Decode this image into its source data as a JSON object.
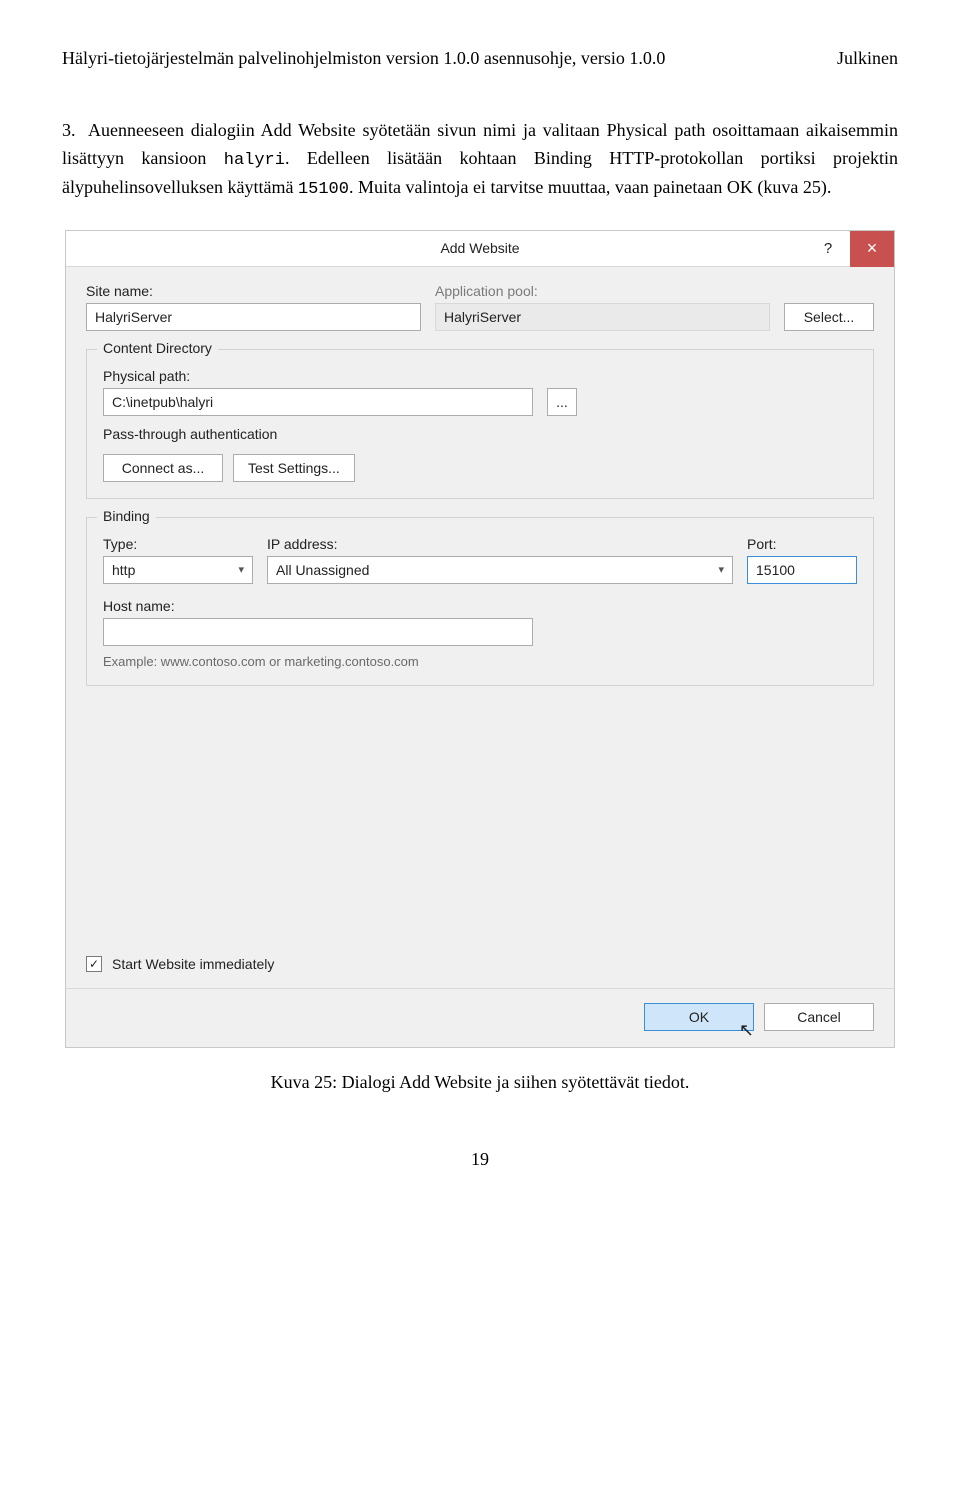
{
  "header": {
    "left": "Hälyri-tietojärjestelmän palvelinohjelmiston version 1.0.0 asennusohje, versio 1.0.0",
    "right": "Julkinen"
  },
  "paragraph": {
    "num": "3.",
    "t1": "Auenneeseen dialogiin Add Website syötetään sivun nimi ja valitaan Physical path osoittamaan aikaisemmin lisättyyn kansioon ",
    "code1": "halyri",
    "t2": ". Edelleen lisätään kohtaan Binding HTTP-protokollan portiksi projektin älypuhelinsovelluksen käyttämä ",
    "code2": "15100",
    "t3": ". Muita valintoja ei tarvitse muuttaa, vaan painetaan OK (kuva 25)."
  },
  "dialog": {
    "title": "Add Website",
    "help": "?",
    "close": "×",
    "siteName": {
      "label": "Site name:",
      "value": "HalyriServer"
    },
    "appPool": {
      "label": "Application pool:",
      "value": "HalyriServer",
      "selectBtn": "Select..."
    },
    "content": {
      "legend": "Content Directory",
      "physicalPath": {
        "label": "Physical path:",
        "value": "C:\\inetpub\\halyri",
        "browse": "..."
      },
      "passThrough": "Pass-through authentication",
      "connectAs": "Connect as...",
      "testSettings": "Test Settings..."
    },
    "binding": {
      "legend": "Binding",
      "type": {
        "label": "Type:",
        "value": "http"
      },
      "ip": {
        "label": "IP address:",
        "value": "All Unassigned"
      },
      "port": {
        "label": "Port:",
        "value": "15100"
      },
      "hostName": {
        "label": "Host name:",
        "value": ""
      },
      "example": "Example: www.contoso.com or marketing.contoso.com"
    },
    "startImmediately": {
      "checked": "✓",
      "label": "Start Website immediately"
    },
    "ok": "OK",
    "cancel": "Cancel"
  },
  "caption": "Kuva 25: Dialogi Add Website ja siihen syötettävät tiedot.",
  "pageNum": "19"
}
